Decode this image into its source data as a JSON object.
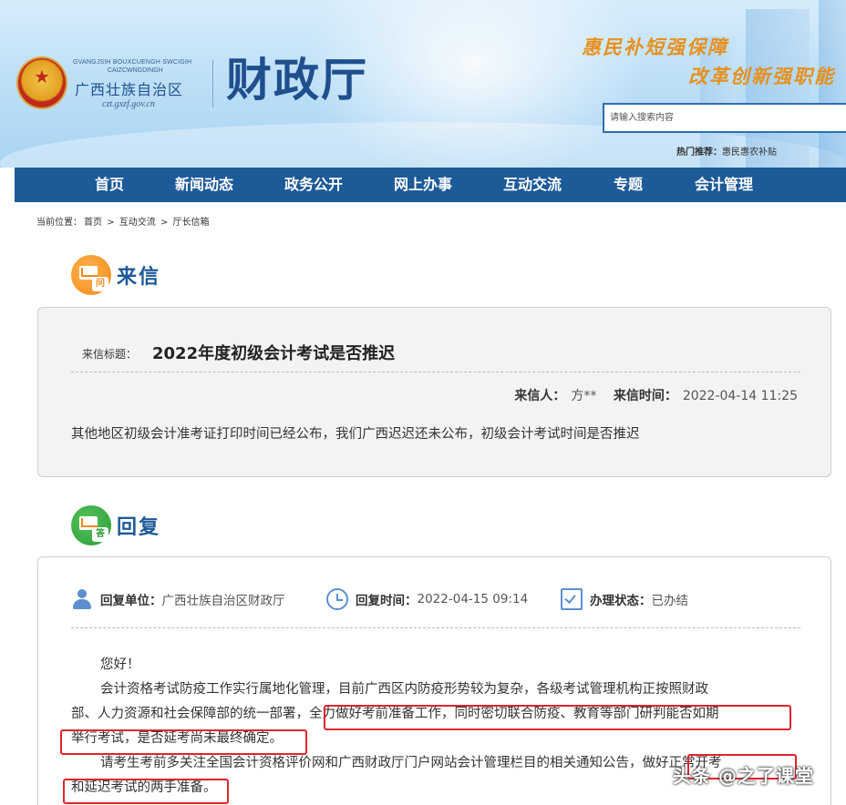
{
  "header": {
    "emblem_text_en1": "GVANGJSIH BOUXCUENGH SWCIGIH",
    "emblem_text_en2": "CAIZCWNGDINGH",
    "region_name": "广西壮族自治区",
    "url": "czt.gxzf.gov.cn",
    "site_title": "财政厅",
    "slogan_line1": "惠民补短强保障",
    "slogan_line2": "改革创新强职能",
    "search_placeholder": "请输入搜索内容",
    "hot_label": "热门推荐：",
    "hot_link": "惠民惠农补贴"
  },
  "nav": {
    "items": [
      "首页",
      "新闻动态",
      "政务公开",
      "网上办事",
      "互动交流",
      "专题",
      "会计管理"
    ]
  },
  "breadcrumb": {
    "prefix": "当前位置：",
    "items": [
      "首页",
      ">",
      "互动交流",
      ">",
      "厅长信箱"
    ]
  },
  "letter": {
    "section_title": "来信",
    "icon_tag": "问",
    "title_label": "来信标题：",
    "title": "2022年度初级会计考试是否推迟",
    "sender_label": "来信人：",
    "sender": "方**",
    "time_label": "来信时间：",
    "time": "2022-04-14 11:25",
    "body": "其他地区初级会计准考证打印时间已经公布，我们广西迟迟还未公布，初级会计考试时间是否推迟"
  },
  "reply": {
    "section_title": "回复",
    "icon_tag": "答",
    "unit_label": "回复单位：",
    "unit": "广西壮族自治区财政厅",
    "time_label": "回复时间：",
    "time": "2022-04-15 09:14",
    "status_label": "办理状态：",
    "status": "已办结",
    "greeting": "您好！",
    "para1_line1": "会计资格考试防疫工作实行属地化管理，目前广西区内防疫形势较为复杂，各级考试管理机构正按照财政",
    "para1_line2": "部、人力资源和社会保障部的统一部署，全力做好考前准备工作，同时密切联合防疫、教育等部门研判能否如期",
    "para1_line3": "举行考试，是否延考尚未最终确定。",
    "para2_line1": "请考生考前多关注全国会计资格评价网和广西财政厅门户网站会计管理栏目的相关通知公告，做好正常开考",
    "para2_line2": "和延迟考试的两手准备。"
  },
  "watermark": "头条 @之了课堂",
  "colors": {
    "nav_bg": "#1d5a98",
    "highlight": "#e0252b",
    "slogan": "#e6911e"
  }
}
